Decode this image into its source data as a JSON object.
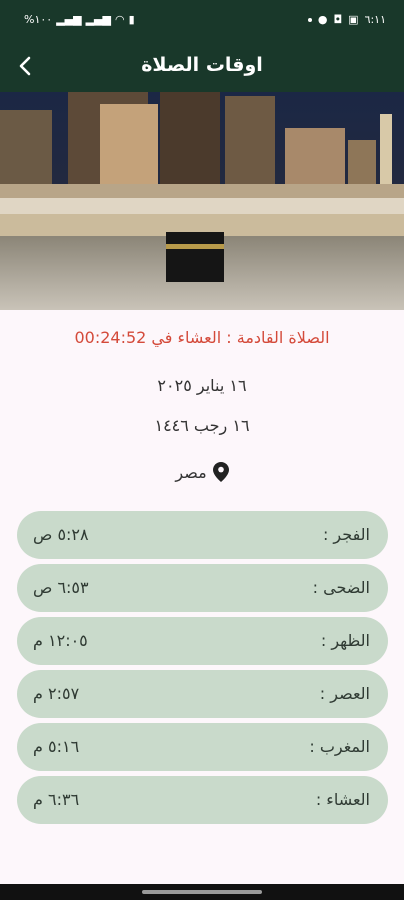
{
  "status_bar": {
    "time": "٦:١١",
    "battery": "%١٠٠"
  },
  "app_bar": {
    "title": "اوقات الصلاة"
  },
  "next_prayer": "الصلاة القادمة : العشاء في 00:24:52",
  "gregorian_date": "١٦ يناير ٢٠٢٥",
  "hijri_date": "١٦ رجب ١٤٤٦",
  "location": "مصر",
  "prayers": [
    {
      "name": "الفجر :",
      "time": "٥:٢٨ ص"
    },
    {
      "name": "الضحى :",
      "time": "٦:٥٣ ص"
    },
    {
      "name": "الظهر :",
      "time": "١٢:٠٥ م"
    },
    {
      "name": "العصر :",
      "time": "٢:٥٧ م"
    },
    {
      "name": "المغرب :",
      "time": "٥:١٦ م"
    },
    {
      "name": "العشاء :",
      "time": "٦:٣٦ م"
    }
  ],
  "colors": {
    "app_bar": "#19382a",
    "next_prayer_text": "#d44a3a",
    "prayer_row_bg": "#c9dacb",
    "page_bg": "#fdf7fb"
  }
}
